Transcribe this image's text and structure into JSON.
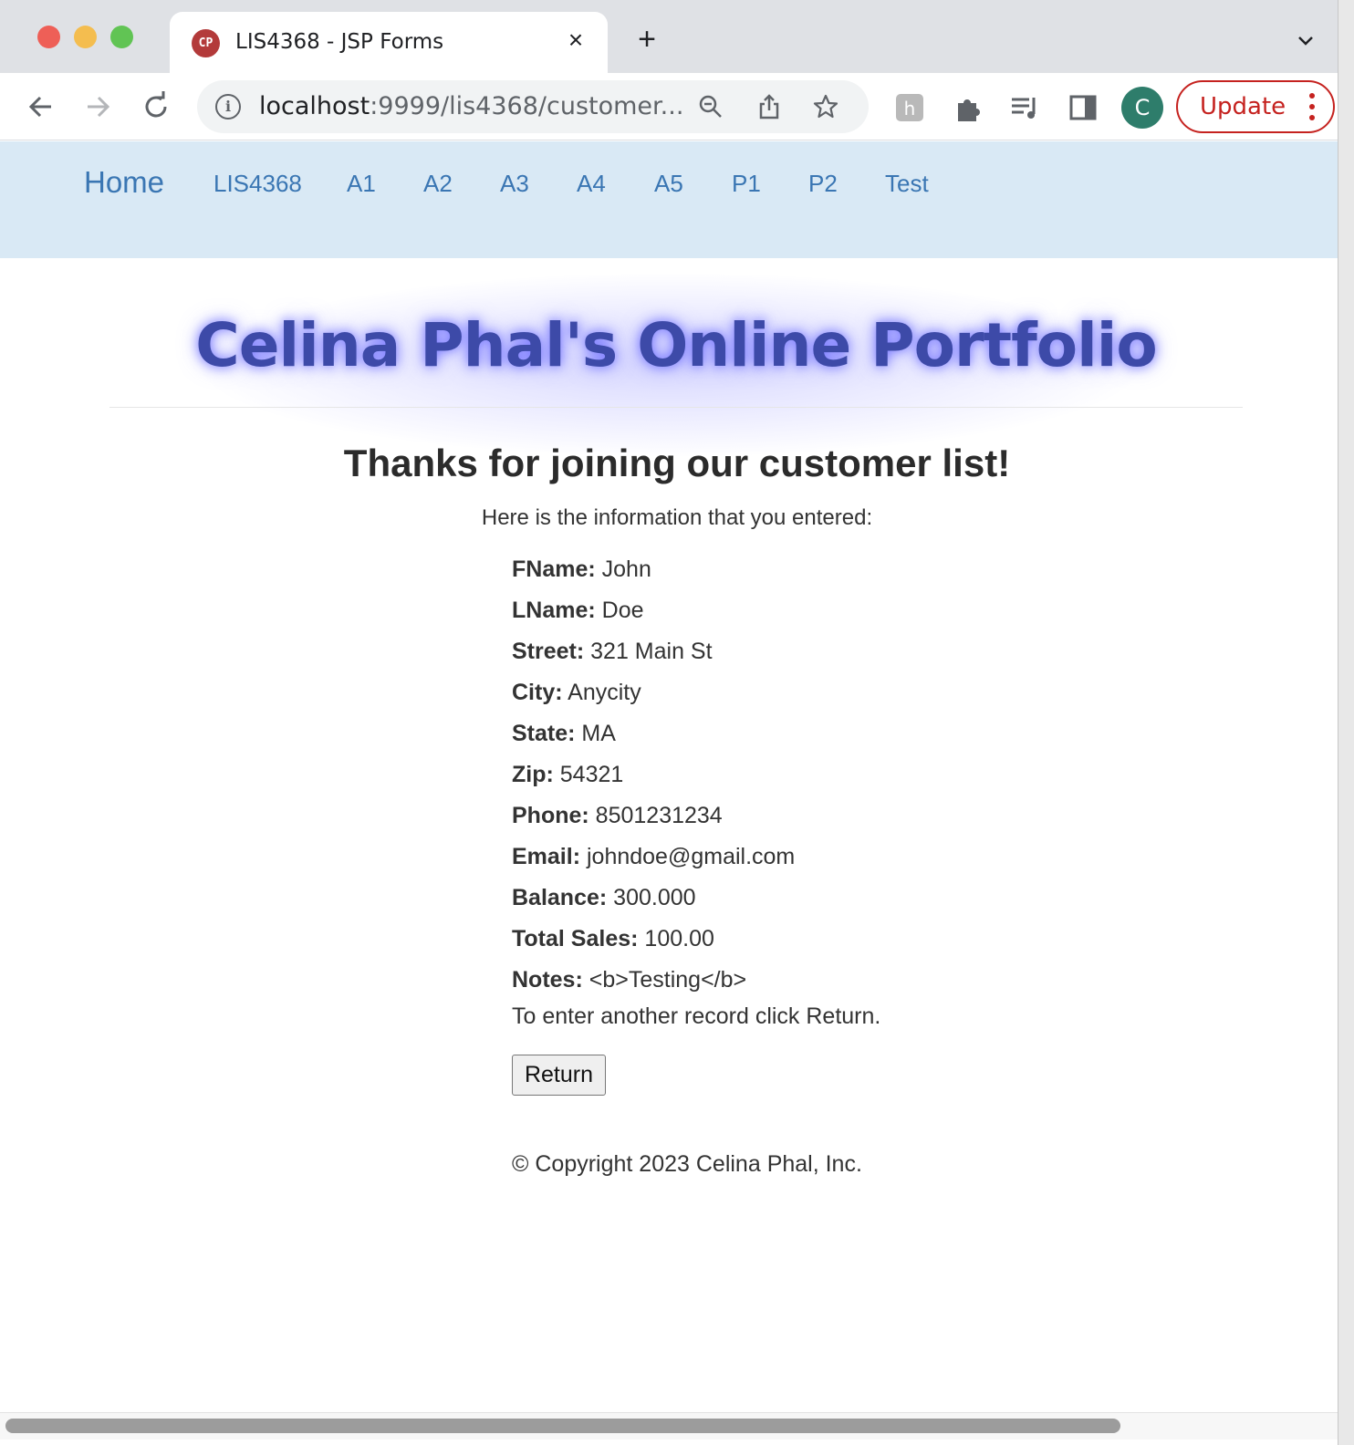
{
  "browser": {
    "tab": {
      "favicon_text": "CP",
      "title": "LIS4368 - JSP Forms",
      "close": "×"
    },
    "new_tab": "+",
    "omnibox": {
      "host": "localhost",
      "path": ":9999/lis4368/customer..."
    },
    "profile_initial": "C",
    "update_label": "Update"
  },
  "nav": {
    "brand": "Home",
    "links": [
      "LIS4368",
      "A1",
      "A2",
      "A3",
      "A4",
      "A5",
      "P1",
      "P2",
      "Test"
    ]
  },
  "page": {
    "banner": "Celina Phal's Online Portfolio",
    "heading": "Thanks for joining our customer list!",
    "intro": "Here is the information that you entered:",
    "fields": [
      {
        "label": "FName:",
        "value": "John"
      },
      {
        "label": "LName:",
        "value": "Doe"
      },
      {
        "label": "Street:",
        "value": "321 Main St"
      },
      {
        "label": "City:",
        "value": "Anycity"
      },
      {
        "label": "State:",
        "value": "MA"
      },
      {
        "label": "Zip:",
        "value": "54321"
      },
      {
        "label": "Phone:",
        "value": "8501231234"
      },
      {
        "label": "Email:",
        "value": "johndoe@gmail.com"
      },
      {
        "label": "Balance:",
        "value": "300.000"
      },
      {
        "label": "Total Sales:",
        "value": "100.00"
      },
      {
        "label": "Notes:",
        "value": "<b>Testing</b>"
      }
    ],
    "again_text": "To enter another record click Return.",
    "return_label": "Return",
    "footer": "© Copyright 2023 Celina Phal, Inc."
  },
  "colors": {
    "navbar_bg": "#d9e9f5",
    "link": "#3a76b3",
    "banner": "#3d4aa8",
    "update_red": "#c5221f",
    "avatar": "#2e7d6b"
  }
}
